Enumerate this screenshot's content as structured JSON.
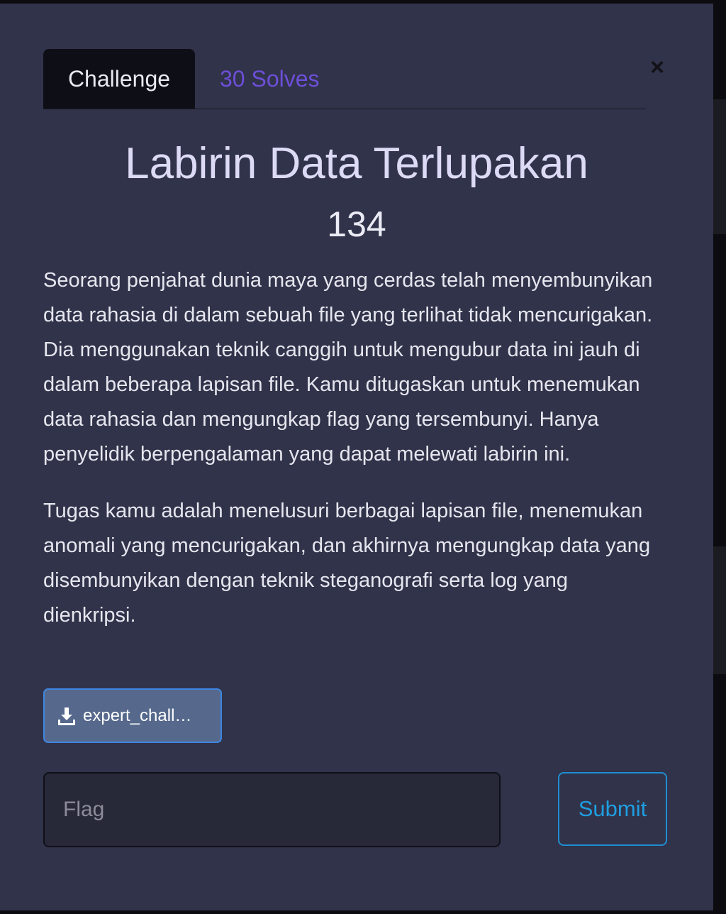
{
  "tabs": {
    "challenge_label": "Challenge",
    "solves_label": "30 Solves"
  },
  "close": {
    "symbol": "×"
  },
  "challenge": {
    "title": "Labirin Data Terlupakan",
    "points": "134",
    "description": [
      "Seorang penjahat dunia maya yang cerdas telah menyembunyikan data rahasia di dalam sebuah file yang terlihat tidak mencurigakan. Dia menggunakan teknik canggih untuk mengubur data ini jauh di dalam beberapa lapisan file. Kamu ditugaskan untuk menemukan data rahasia dan mengungkap flag yang tersembunyi. Hanya penyelidik berpengalaman yang dapat melewati labirin ini.",
      "Tugas kamu adalah menelusuri berbagai lapisan file, menemukan anomali yang mencurigakan, dan akhirnya mengungkap data yang disembunyikan dengan teknik steganografi serta log yang dienkripsi."
    ]
  },
  "file": {
    "name": "expert_chall…",
    "icon": "download-icon"
  },
  "form": {
    "flag_placeholder": "Flag",
    "flag_value": "",
    "submit_label": "Submit"
  },
  "colors": {
    "modal_bg": "#31334a",
    "tab_active_bg": "#0e0e17",
    "solves_link": "#6d4fd8",
    "submit_accent": "#1f9ee0",
    "file_button_bg": "#56698c"
  }
}
